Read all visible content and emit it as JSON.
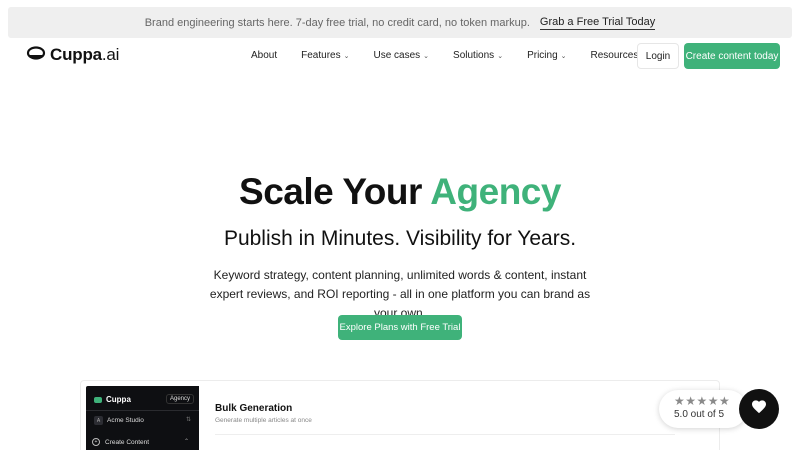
{
  "banner": {
    "text": "Brand engineering starts here. 7-day free trial, no credit card, no token markup.",
    "cta": "Grab a Free Trial Today"
  },
  "nav": {
    "logo_main": "Cuppa",
    "logo_suffix": ".ai",
    "items": [
      {
        "label": "About"
      },
      {
        "label": "Features",
        "chevron": "⌄"
      },
      {
        "label": "Use cases",
        "chevron": "⌄"
      },
      {
        "label": "Solutions",
        "chevron": "⌄"
      },
      {
        "label": "Pricing",
        "chevron": "⌄"
      },
      {
        "label": "Resources",
        "chevron": "⌄"
      }
    ],
    "login": "Login",
    "create": "Create content today"
  },
  "hero": {
    "title_main": "Scale Your ",
    "title_accent": "Agency",
    "subtitle": "Publish in Minutes. Visibility for Years.",
    "description": "Keyword strategy, content planning, unlimited words & content, instant expert reviews, and ROI reporting - all in one platform you can brand as your own.",
    "cta": "Explore Plans with Free Trial"
  },
  "app_preview": {
    "brand": "Cuppa",
    "badge": "Agency",
    "workspace_initial": "A",
    "workspace": "Acme Studio",
    "menu_item": "Create Content",
    "panel_title": "Bulk Generation",
    "panel_subtitle": "Generate multiple articles at once"
  },
  "rating": {
    "stars": "★★★★★",
    "text": "5.0 out of 5"
  },
  "colors": {
    "accent": "#3fb27a",
    "dark": "#111111"
  },
  "icons": {
    "heart": "heart-icon",
    "logo": "cup-logo-icon"
  }
}
